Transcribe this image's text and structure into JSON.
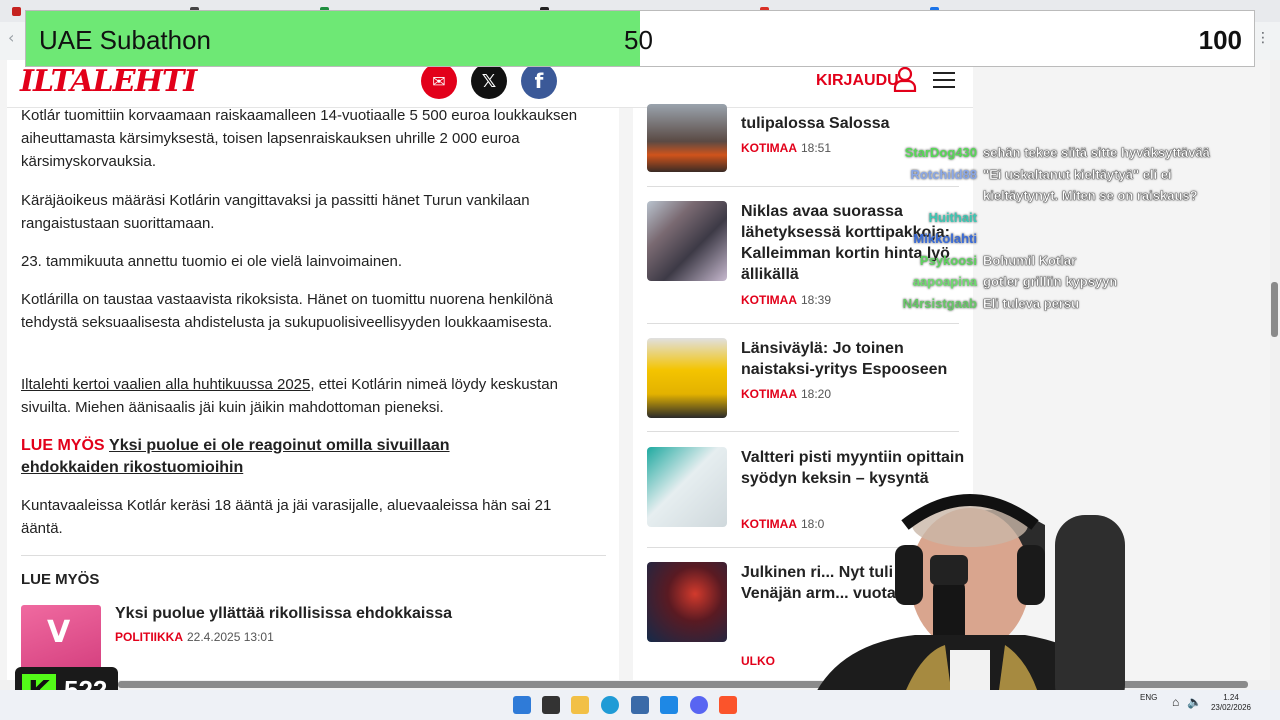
{
  "overlay": {
    "name": "UAE Subathon",
    "current": "50",
    "max": "100",
    "progress_fraction": 0.5
  },
  "site": {
    "logo": "ILTALEHTI",
    "login_label": "KIRJAUDU"
  },
  "article": {
    "paragraphs": [
      "Kotlár tuomittiin korvaamaan raiskaamalleen 14-vuotiaalle 5 500 euroa loukkauksen aiheuttamasta kärsimyksestä, toisen lapsenraiskauksen uhrille 2 000 euroa kärsimyskorvauksia.",
      "Käräjäoikeus määräsi Kotlárin vangittavaksi ja passitti hänet Turun vankilaan rangaistustaan suorittamaan.",
      "23. tammikuuta annettu tuomio ei ole vielä lainvoimainen.",
      "Kotlárilla on taustaa vastaavista rikoksista. Hänet on tuomittu nuorena henkilönä tehdystä seksuaalisesta ahdistelusta ja sukupuolisiveellisyyden loukkaamisesta."
    ],
    "linked_para": {
      "link": "Iltalehti kertoi vaalien alla huhtikuussa 2025",
      "rest": ", ettei Kotlárin nimeä löydy keskustan sivuilta. Miehen äänisaalis jäi kuin jäikin mahdottoman pieneksi."
    },
    "lue_label": "LUE MYÖS",
    "lue_link": "Yksi puolue ei ole reagoinut omilla sivuillaan ehdokkaiden rikostuomioihin",
    "last_para": "Kuntavaaleissa Kotlár keräsi 18 ääntä ja jäi varasijalle, aluevaaleissa hän sai 21 ääntä.",
    "section_title": "LUE MYÖS",
    "related": {
      "title": "Yksi puolue yllättää rikollisissa ehdokkaissa",
      "category": "POLITIIKKA",
      "time": "22.4.2025 13:01"
    }
  },
  "rail": [
    {
      "title": "tulipalossa Salossa",
      "category": "KOTIMAA",
      "time": "18:51"
    },
    {
      "title": "Niklas avaa suorassa lähetyksessä korttipakkoja: Kalleimman kortin hinta lyö ällikällä",
      "category": "KOTIMAA",
      "time": "18:39"
    },
    {
      "title": "Länsiväylä: Jo toinen naistaksi-yritys Espooseen",
      "category": "KOTIMAA",
      "time": "18:20"
    },
    {
      "title": "Valtteri pisti myyntiin opittain syödyn keksin – kysyntä",
      "category": "KOTIMAA",
      "time": "18:0"
    },
    {
      "title": "Julkinen ri... Nyt tuli mi... Venäjän arm... vuotaa",
      "category": "ULKO",
      "time": ""
    }
  ],
  "chat": [
    {
      "user": "StarDog430",
      "color": "#57d957",
      "msg": "sehän tekee siitä sitte hyväksyttävää"
    },
    {
      "user": "Rotchild88",
      "color": "#8aa8e8",
      "msg": "\"Ei uskaltanut kieltäytyä\" eli ei"
    },
    {
      "user": "",
      "color": "#ffffff",
      "msg": "kieltäytynyt. Miten se on raiskaus?"
    },
    {
      "user": "Huithait",
      "color": "#3cc8b4",
      "msg": ""
    },
    {
      "user": "Mikkolahti",
      "color": "#3a6bd8",
      "msg": ""
    },
    {
      "user": "Psykoosi",
      "color": "#5fd35f",
      "msg": "Bohumil Kotlar"
    },
    {
      "user": "aapoapina",
      "color": "#6fdc6f",
      "msg": "gotler grilliin kypsyyn"
    },
    {
      "user": "N4rsistgaab",
      "color": "#67c867",
      "msg": "Eli tuleva persu"
    }
  ],
  "counter": {
    "value": "522"
  },
  "taskbar": {
    "lang": "ENG",
    "time": "1.24",
    "date": "23/02/2026"
  },
  "colors": {
    "brand_red": "#e2001a",
    "progress_green": "#6ee875",
    "kick_green": "#53fc18"
  }
}
